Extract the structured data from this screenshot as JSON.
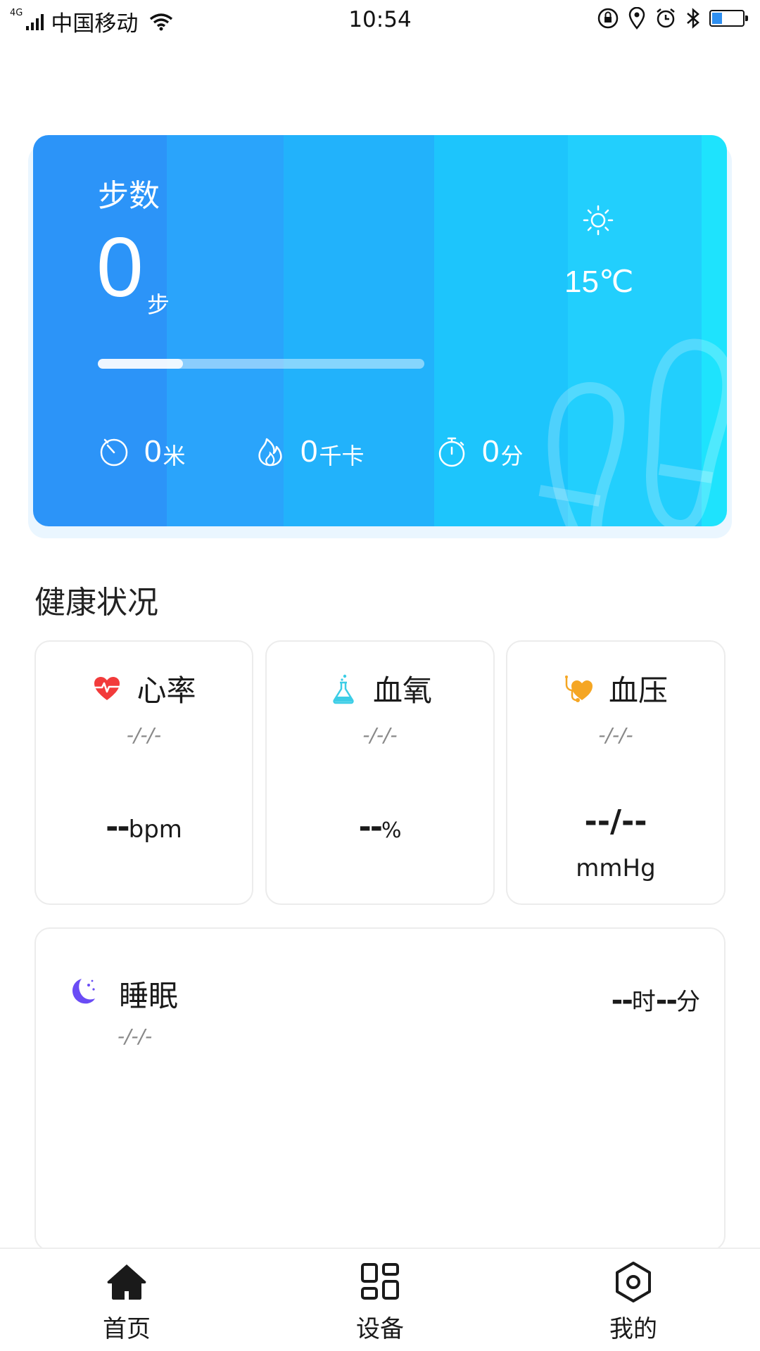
{
  "status_bar": {
    "network": "4G",
    "carrier": "中国移动",
    "time": "10:54",
    "battery_level": 0.4
  },
  "steps_card": {
    "title": "步数",
    "value": "0",
    "unit": "步",
    "progress": 0.26,
    "temperature": "15℃",
    "weather_icon": "sun-icon",
    "metrics": [
      {
        "icon": "distance-icon",
        "value": "0",
        "unit": "米"
      },
      {
        "icon": "flame-icon",
        "value": "0",
        "unit": "千卡"
      },
      {
        "icon": "stopwatch-icon",
        "value": "0",
        "unit": "分"
      }
    ]
  },
  "health": {
    "section_title": "健康状况",
    "heart_rate": {
      "icon": "heart-rate-icon",
      "title": "心率",
      "date": "-/-/-",
      "value": "--",
      "unit": "bpm"
    },
    "blood_oxygen": {
      "icon": "flask-icon",
      "title": "血氧",
      "date": "-/-/-",
      "value": "--",
      "unit": "%"
    },
    "blood_pressure": {
      "icon": "stethoscope-heart-icon",
      "title": "血压",
      "date": "-/-/-",
      "value": "--/--",
      "unit": "mmHg"
    }
  },
  "sleep": {
    "icon": "moon-icon",
    "title": "睡眠",
    "date": "-/-/-",
    "hours_value": "--",
    "hours_unit": "时",
    "minutes_value": "--",
    "minutes_unit": "分"
  },
  "nav": {
    "items": [
      {
        "icon": "home-icon",
        "label": "首页",
        "active": true
      },
      {
        "icon": "grid-icon",
        "label": "设备",
        "active": false
      },
      {
        "icon": "hexagon-settings-icon",
        "label": "我的",
        "active": false
      }
    ]
  },
  "colors": {
    "accent_blue": "#2c94f8",
    "accent_cyan": "#1ee3fd",
    "heart_red": "#f23b3b",
    "flask_cyan": "#3ccde6",
    "pressure_orange": "#f5a623",
    "moon_purple": "#6a4cf5"
  }
}
